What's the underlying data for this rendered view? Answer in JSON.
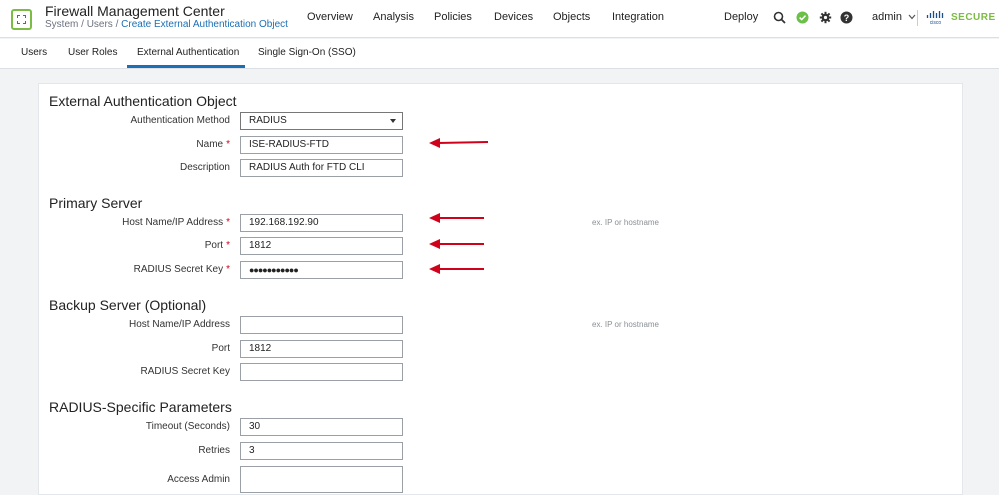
{
  "header": {
    "app_title": "Firewall Management Center",
    "breadcrumb_parts": [
      "System",
      "Users"
    ],
    "breadcrumb_sep": " / ",
    "breadcrumb_current": "Create External Authentication Object",
    "nav": [
      "Overview",
      "Analysis",
      "Policies",
      "Devices",
      "Objects",
      "Integration"
    ],
    "deploy_label": "Deploy",
    "user_label": "admin",
    "brand_label": "SECURE",
    "brand_color": "#7cbb45",
    "status_color": "#6cc04a"
  },
  "tabs": [
    "Users",
    "User Roles",
    "External Authentication",
    "Single Sign-On (SSO)"
  ],
  "form": {
    "title": "External Authentication Object",
    "auth_method": {
      "label": "Authentication Method",
      "value": "RADIUS"
    },
    "name": {
      "label": "Name",
      "value": "ISE-RADIUS-FTD",
      "required": "*"
    },
    "description": {
      "label": "Description",
      "value": "RADIUS Auth for FTD CLI"
    }
  },
  "primary": {
    "title": "Primary Server",
    "host": {
      "label": "Host Name/IP Address",
      "value": "192.168.192.90",
      "required": "*",
      "hint": "ex. IP or hostname"
    },
    "port": {
      "label": "Port",
      "value": "1812",
      "required": "*"
    },
    "secret": {
      "label": "RADIUS Secret Key",
      "value": "●●●●●●●●●●●",
      "required": "*"
    }
  },
  "backup": {
    "title": "Backup Server (Optional)",
    "host": {
      "label": "Host Name/IP Address",
      "value": "",
      "hint": "ex. IP or hostname"
    },
    "port": {
      "label": "Port",
      "value": "1812"
    },
    "secret": {
      "label": "RADIUS Secret Key",
      "value": ""
    }
  },
  "radius": {
    "title": "RADIUS-Specific Parameters",
    "timeout": {
      "label": "Timeout (Seconds)",
      "value": "30"
    },
    "retries": {
      "label": "Retries",
      "value": "3"
    },
    "access_admin": {
      "label": "Access Admin",
      "value": ""
    }
  },
  "annotation_color": "#d0021b"
}
